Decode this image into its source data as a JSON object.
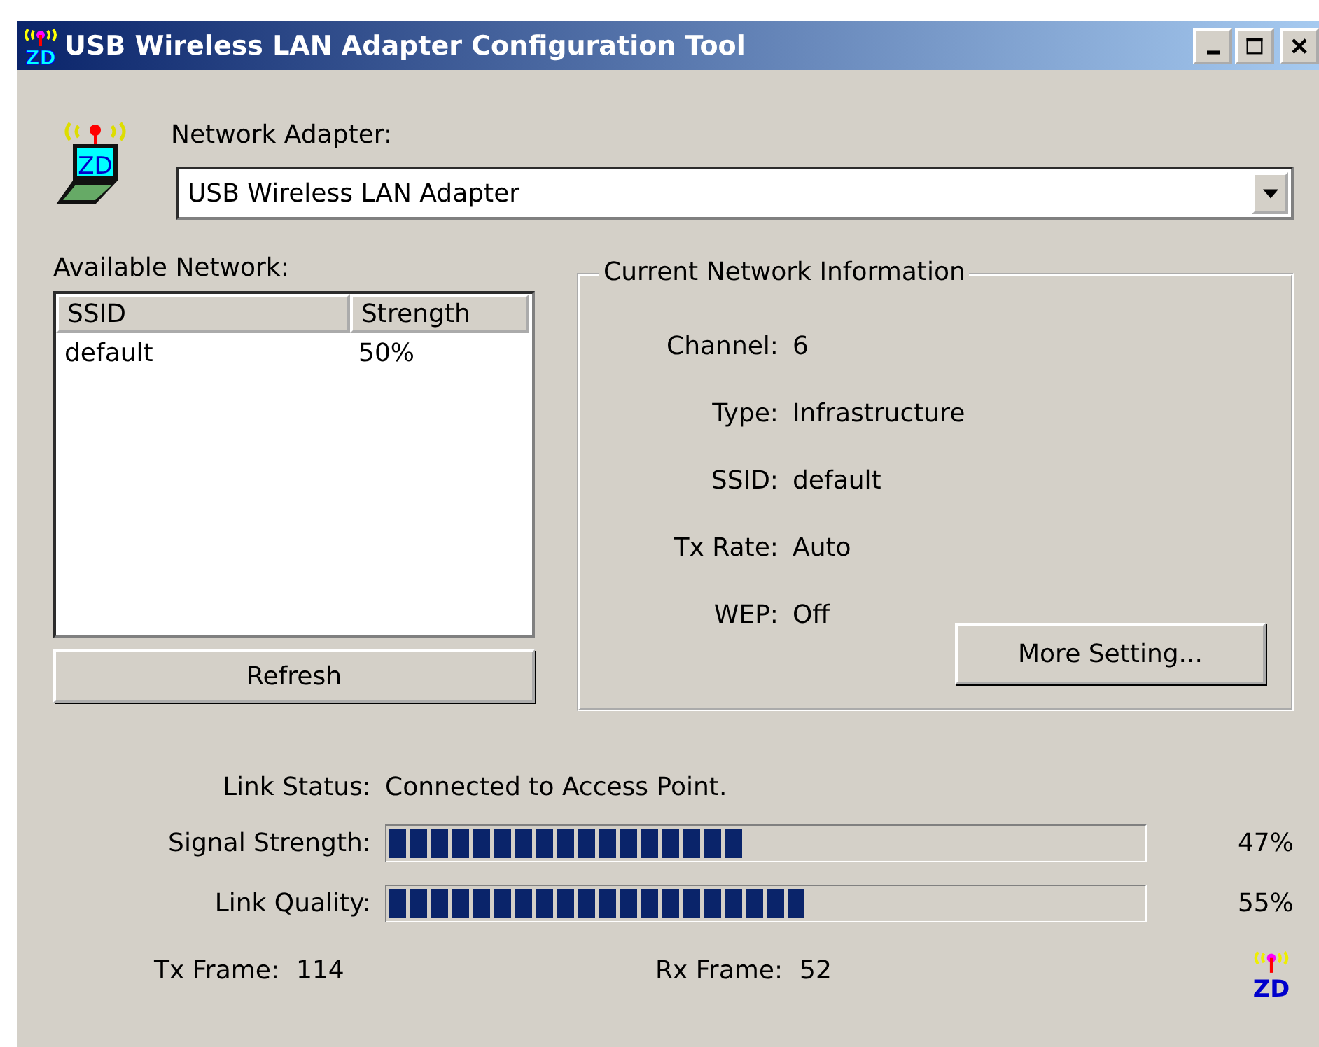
{
  "window": {
    "title": "USB Wireless LAN Adapter Configuration Tool",
    "icon_text": "ZD"
  },
  "adapter_icon_text": "ZD",
  "network_adapter": {
    "label": "Network Adapter:",
    "value": "USB Wireless LAN Adapter"
  },
  "available_network": {
    "label": "Available Network:",
    "columns": [
      "SSID",
      "Strength"
    ],
    "rows": [
      {
        "ssid": "default",
        "strength": "50%"
      }
    ],
    "refresh_button": "Refresh"
  },
  "current_network": {
    "title": "Current Network Information",
    "fields": [
      {
        "label": "Channel:",
        "value": "6"
      },
      {
        "label": "Type:",
        "value": "Infrastructure"
      },
      {
        "label": "SSID:",
        "value": "default"
      },
      {
        "label": "Tx Rate:",
        "value": "Auto"
      },
      {
        "label": "WEP:",
        "value": "Off"
      }
    ],
    "more_button": "More Setting..."
  },
  "link_status": {
    "label": "Link Status:",
    "value": "Connected to Access Point."
  },
  "meters": [
    {
      "label": "Signal Strength:",
      "level": 0.47,
      "reading": "47%"
    },
    {
      "label": "Link Quality:",
      "level": 0.55,
      "reading": "55%"
    }
  ],
  "frames": [
    {
      "label": "Tx Frame:",
      "value": "114"
    },
    {
      "label": "Rx Frame:",
      "value": "52"
    }
  ],
  "corner_logo_text": "ZD"
}
